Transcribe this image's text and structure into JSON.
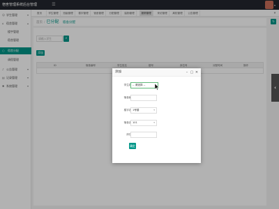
{
  "app": {
    "title": "宿舍管理系统后台管理"
  },
  "sidebar": {
    "items": [
      {
        "label": "学生管理",
        "icon": "user-icon",
        "expandable": true
      },
      {
        "label": "宿舍管理",
        "icon": "home-icon",
        "expandable": true
      },
      {
        "label": "楼宇管理",
        "sub": true
      },
      {
        "label": "宿舍管理",
        "sub": true
      },
      {
        "label": "宿舍分配",
        "sub": true,
        "active": true
      },
      {
        "label": "调宿管理",
        "sub": true
      },
      {
        "label": "公告管理",
        "icon": "bell-icon",
        "expandable": true
      },
      {
        "label": "记录管理",
        "icon": "file-icon",
        "expandable": true
      },
      {
        "label": "系统管理",
        "icon": "gear-icon",
        "expandable": true
      }
    ]
  },
  "tabs": [
    {
      "label": "首页"
    },
    {
      "label": "学生管理"
    },
    {
      "label": "班级管理"
    },
    {
      "label": "楼宇管理"
    },
    {
      "label": "宿舍管理"
    },
    {
      "label": "分配管理"
    },
    {
      "label": "缺勤管理"
    },
    {
      "label": "报修管理",
      "active": true
    },
    {
      "label": "来访管理"
    },
    {
      "label": "离校管理"
    },
    {
      "label": "公告管理"
    }
  ],
  "breadcrumb": {
    "home": "首页",
    "current": "已分配",
    "sub": "宿舍分配"
  },
  "search": {
    "placeholder": "请输入学生"
  },
  "toolbar": {
    "add_label": "添加"
  },
  "table": {
    "headers": [
      "ID",
      "宿舍编号",
      "学生姓名",
      "楼号",
      "床位号",
      "分配时间",
      "操作"
    ]
  },
  "modal": {
    "title": "添加",
    "fields": [
      {
        "label": "学生姓名",
        "value": "-- 请选择 --",
        "type": "select",
        "focused": true
      },
      {
        "label": "宿舍编号",
        "value": "",
        "type": "input"
      },
      {
        "label": "楼宇名称",
        "value": "1号楼",
        "type": "select"
      },
      {
        "label": "宿舍名称",
        "value": "101",
        "type": "select"
      },
      {
        "label": "床位号",
        "value": "",
        "type": "input"
      }
    ],
    "submit_label": "确定"
  },
  "colors": {
    "accent": "#009688",
    "topbar": "#23262e"
  }
}
